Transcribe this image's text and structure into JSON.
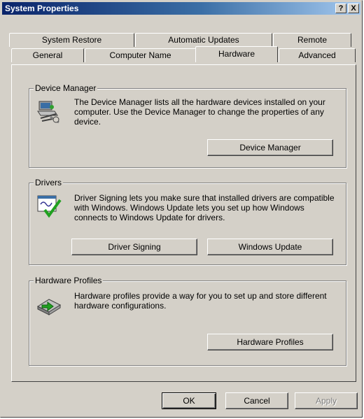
{
  "window": {
    "title": "System Properties",
    "help_label": "?",
    "close_label": "X"
  },
  "tabs": {
    "row1": [
      "System Restore",
      "Automatic Updates",
      "Remote"
    ],
    "row2": [
      "General",
      "Computer Name",
      "Hardware",
      "Advanced"
    ],
    "active": "Hardware"
  },
  "device_manager": {
    "legend": "Device Manager",
    "description": "The Device Manager lists all the hardware devices installed on your computer. Use the Device Manager to change the properties of any device.",
    "button": "Device Manager",
    "icon": "device-manager-icon"
  },
  "drivers": {
    "legend": "Drivers",
    "description": "Driver Signing lets you make sure that installed drivers are compatible with Windows. Windows Update lets you set up how Windows connects to Windows Update for drivers.",
    "signing_button": "Driver Signing",
    "update_button": "Windows Update",
    "icon": "driver-signing-icon"
  },
  "hardware_profiles": {
    "legend": "Hardware Profiles",
    "description": "Hardware profiles provide a way for you to set up and store different hardware configurations.",
    "button": "Hardware Profiles",
    "icon": "hardware-profiles-icon"
  },
  "footer": {
    "ok": "OK",
    "cancel": "Cancel",
    "apply": "Apply"
  },
  "colors": {
    "face": "#d4d0c8",
    "title_start": "#0a246a",
    "title_end": "#a6caf0"
  }
}
